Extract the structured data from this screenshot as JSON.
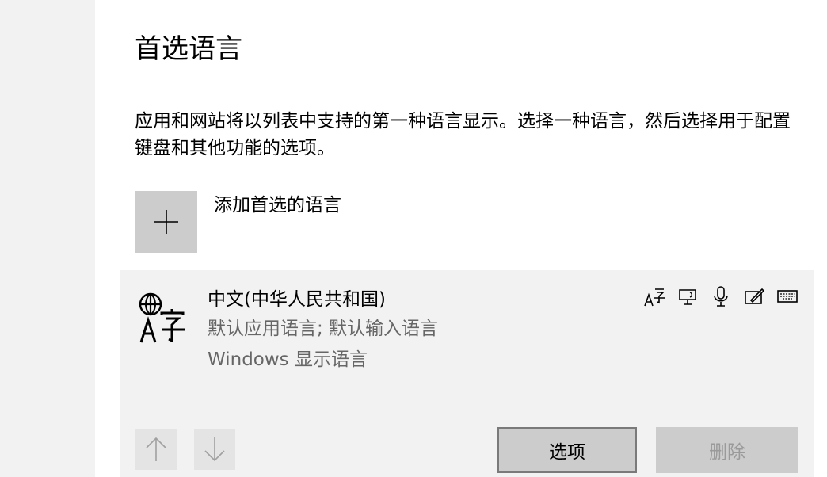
{
  "header": {
    "title": "首选语言",
    "description": "应用和网站将以列表中支持的第一种语言显示。选择一种语言，然后选择用于配置键盘和其他功能的选项。"
  },
  "add_language": {
    "label": "添加首选的语言",
    "icon": "plus-icon"
  },
  "language": {
    "name": "中文(中华人民共和国)",
    "line1": "默认应用语言; 默认输入语言",
    "line2": "Windows 显示语言",
    "icon": "language-icon",
    "features": [
      "language-pack-icon",
      "text-to-speech-icon",
      "speech-recognition-icon",
      "handwriting-icon",
      "keyboard-icon"
    ]
  },
  "actions": {
    "move_up_icon": "arrow-up-icon",
    "move_down_icon": "arrow-down-icon",
    "options_label": "选项",
    "delete_label": "删除"
  }
}
